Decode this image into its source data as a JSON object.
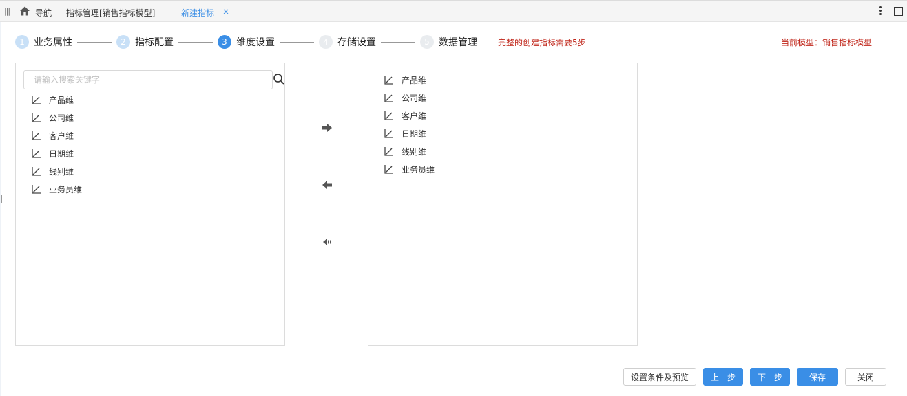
{
  "topbar": {
    "nav_label": "导航",
    "tab_metric_mgmt": "指标管理[销售指标模型]",
    "tab_new_metric": "新建指标",
    "tab_close_glyph": "×"
  },
  "steps": [
    {
      "num": "1",
      "label": "业务属性",
      "state": "done"
    },
    {
      "num": "2",
      "label": "指标配置",
      "state": "done"
    },
    {
      "num": "3",
      "label": "维度设置",
      "state": "active"
    },
    {
      "num": "4",
      "label": "存储设置",
      "state": "todo"
    },
    {
      "num": "5",
      "label": "数据管理",
      "state": "todo"
    }
  ],
  "steps_note": "完整的创建指标需要5步",
  "current_model": "当前模型：销售指标模型",
  "left_panel": {
    "search_placeholder": "请输入搜索关键字",
    "items": [
      {
        "label": "产品维",
        "icon": "dimension-icon"
      },
      {
        "label": "公司维",
        "icon": "dimension-icon"
      },
      {
        "label": "客户维",
        "icon": "dimension-icon"
      },
      {
        "label": "日期维",
        "icon": "dimension-icon"
      },
      {
        "label": "线别维",
        "icon": "dimension-icon"
      },
      {
        "label": "业务员维",
        "icon": "dimension-icon"
      }
    ]
  },
  "right_panel": {
    "items": [
      {
        "label": "产品维",
        "icon": "dimension-icon"
      },
      {
        "label": "公司维",
        "icon": "dimension-icon"
      },
      {
        "label": "客户维",
        "icon": "dimension-icon"
      },
      {
        "label": "日期维",
        "icon": "dimension-icon"
      },
      {
        "label": "线别维",
        "icon": "dimension-icon"
      },
      {
        "label": "业务员维",
        "icon": "dimension-icon"
      }
    ]
  },
  "transfer_icons": [
    "arrow-right-icon",
    "arrow-left-icon",
    "arrow-left-all-icon"
  ],
  "buttons": {
    "preview": "设置条件及预览",
    "prev": "上一步",
    "next": "下一步",
    "save": "保存",
    "close": "关闭"
  },
  "colors": {
    "accent": "#3a8ee6",
    "warning_text": "#c0271b",
    "step_done": "#c8e0f7",
    "step_todo": "#e9ecef"
  }
}
